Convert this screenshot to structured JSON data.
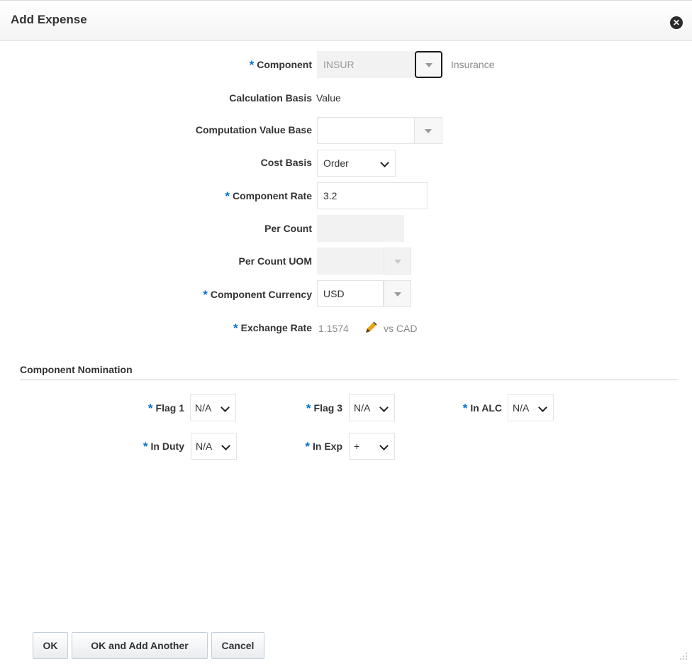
{
  "dialog": {
    "title": "Add Expense"
  },
  "form": {
    "component": {
      "label": "Component",
      "value": "INSUR",
      "description": "Insurance"
    },
    "calculation_basis": {
      "label": "Calculation Basis",
      "value": "Value"
    },
    "computation_value_base": {
      "label": "Computation Value Base",
      "value": ""
    },
    "cost_basis": {
      "label": "Cost Basis",
      "value": "Order"
    },
    "component_rate": {
      "label": "Component Rate",
      "value": "3.2"
    },
    "per_count": {
      "label": "Per Count",
      "value": ""
    },
    "per_count_uom": {
      "label": "Per Count UOM",
      "value": ""
    },
    "component_currency": {
      "label": "Component Currency",
      "value": "USD"
    },
    "exchange_rate": {
      "label": "Exchange Rate",
      "value": "1.1574",
      "suffix": "vs CAD"
    }
  },
  "nomination": {
    "title": "Component Nomination",
    "flag1": {
      "label": "Flag 1",
      "value": "N/A"
    },
    "flag3": {
      "label": "Flag 3",
      "value": "N/A"
    },
    "in_alc": {
      "label": "In ALC",
      "value": "N/A"
    },
    "in_duty": {
      "label": "In Duty",
      "value": "N/A"
    },
    "in_exp": {
      "label": "In Exp",
      "value": "+"
    }
  },
  "buttons": {
    "ok": "OK",
    "ok_add_another": "OK and Add Another",
    "cancel": "Cancel"
  },
  "colors": {
    "required_marker": "#0572ce",
    "section_rule": "#c5d0d8"
  }
}
